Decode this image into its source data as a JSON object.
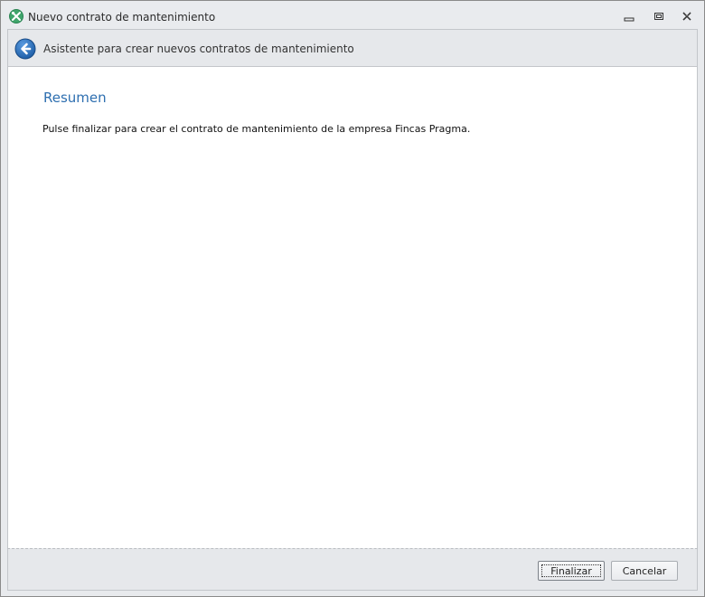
{
  "window": {
    "title": "Nuevo contrato de mantenimiento",
    "icon": "wrench-screwdriver-icon",
    "controls": [
      "minimize-icon",
      "restore-icon",
      "close-icon"
    ]
  },
  "header": {
    "back_icon": "back-arrow-icon",
    "text": "Asistente para crear nuevos contratos de mantenimiento"
  },
  "page": {
    "title": "Resumen",
    "body": "Pulse finalizar para crear el contrato de mantenimiento de la empresa Fincas Pragma."
  },
  "footer": {
    "finish_label": "Finalizar",
    "cancel_label": "Cancelar"
  },
  "colors": {
    "accent_title": "#2e6fb0",
    "back_button": "#1f5fa8",
    "app_icon": "#3fa56b"
  }
}
